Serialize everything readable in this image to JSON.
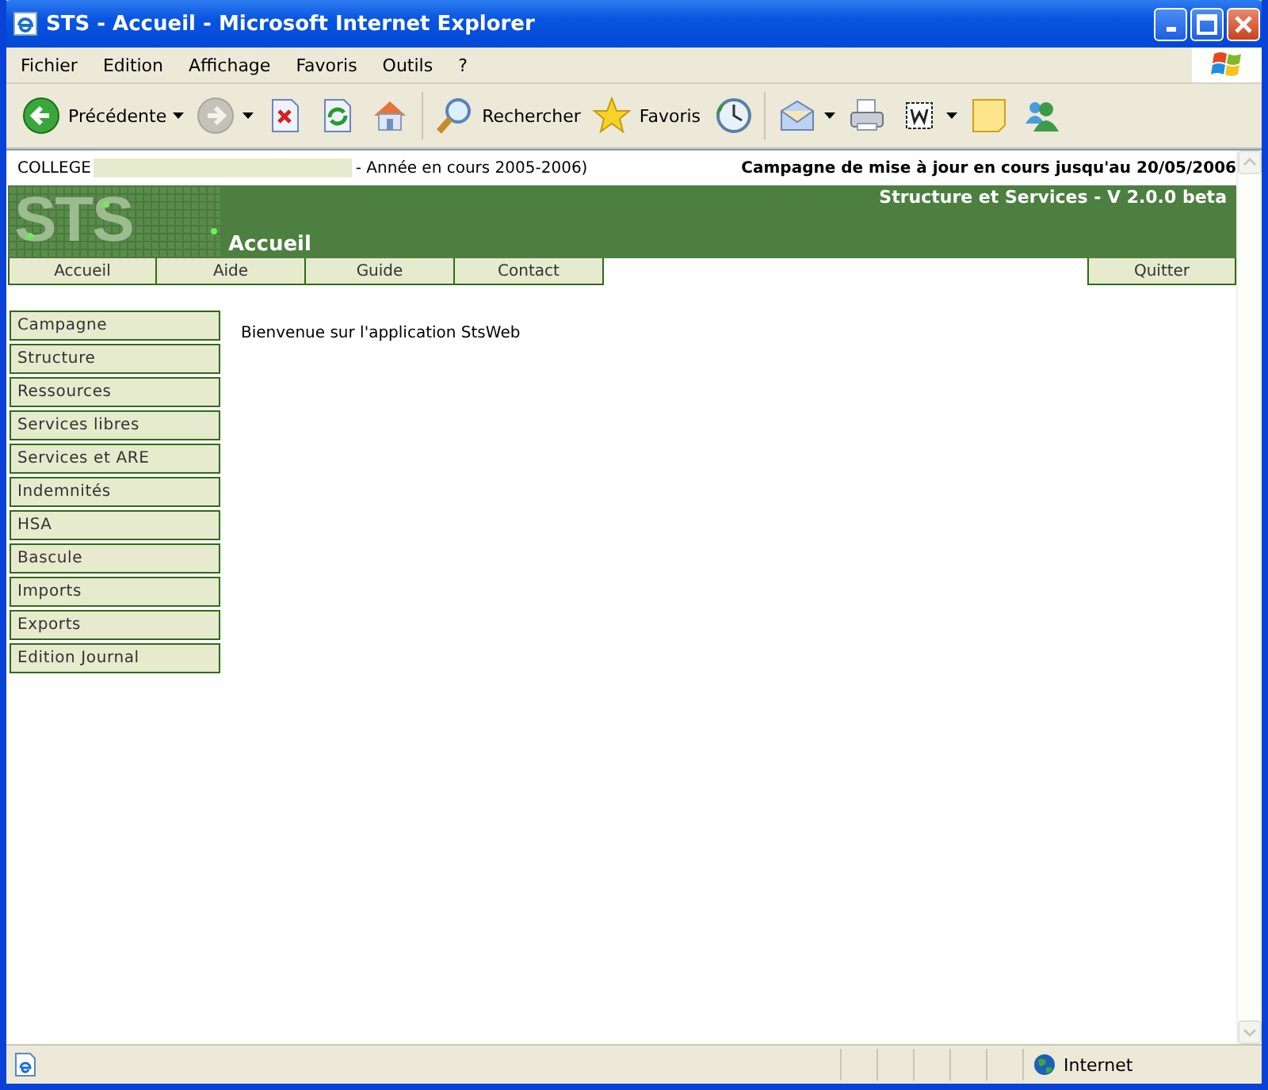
{
  "window": {
    "title": "STS - Accueil - Microsoft Internet Explorer"
  },
  "menu": [
    "Fichier",
    "Edition",
    "Affichage",
    "Favoris",
    "Outils",
    "?"
  ],
  "toolbar": [
    {
      "kind": "back",
      "label": "Précédente",
      "disabled": false,
      "dropdown": true
    },
    {
      "kind": "forward",
      "disabled": true,
      "dropdown": true
    },
    {
      "kind": "stop",
      "disabled": false
    },
    {
      "kind": "refresh",
      "disabled": false
    },
    {
      "kind": "home",
      "disabled": false
    },
    {
      "kind": "sep"
    },
    {
      "kind": "search",
      "label": "Rechercher",
      "disabled": false
    },
    {
      "kind": "favorites",
      "label": "Favoris",
      "disabled": false
    },
    {
      "kind": "history",
      "disabled": false
    },
    {
      "kind": "sep"
    },
    {
      "kind": "mail",
      "disabled": false,
      "dropdown": true
    },
    {
      "kind": "print",
      "disabled": false
    },
    {
      "kind": "edit",
      "disabled": false,
      "dropdown": true
    },
    {
      "kind": "note",
      "disabled": false
    },
    {
      "kind": "messenger",
      "disabled": false
    }
  ],
  "page": {
    "college_label": "COLLEGE",
    "year": "- Année en cours 2005-2006)",
    "campaign": "Campagne de mise à jour en cours jusqu'au 20/05/2006",
    "logo": "STS",
    "app_title": "Structure et Services - V 2.0.0 beta",
    "page_title": "Accueil",
    "nav": [
      {
        "label": "Accueil"
      },
      {
        "label": "Aide"
      },
      {
        "label": "Guide"
      },
      {
        "label": "Contact"
      }
    ],
    "quit": "Quitter",
    "sidebar": [
      "Campagne",
      "Structure",
      "Ressources",
      "Services libres",
      "Services et ARE",
      "Indemnités",
      "HSA",
      "Bascule",
      "Imports",
      "Exports",
      "Edition Journal"
    ],
    "welcome": "Bienvenue sur l'application StsWeb"
  },
  "status_bar": {
    "zone": "Internet"
  }
}
